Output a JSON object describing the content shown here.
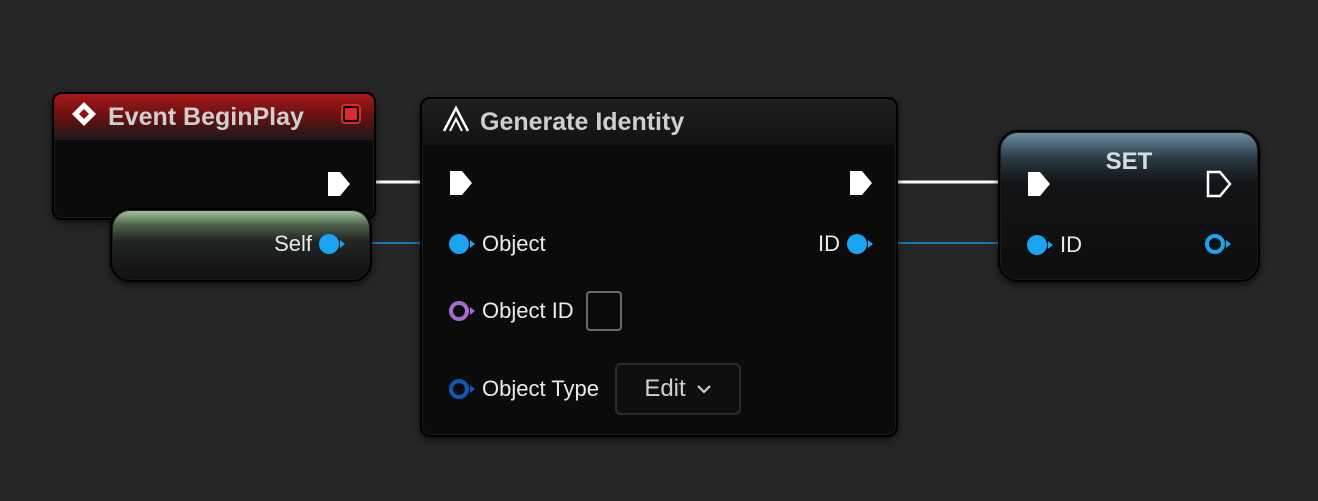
{
  "nodes": {
    "event_begin_play": {
      "title": "Event BeginPlay",
      "colors": {
        "header": "#8a1414",
        "stop": "#e02a2a"
      }
    },
    "self_node": {
      "output_label": "Self"
    },
    "generate_identity": {
      "title": "Generate Identity",
      "inputs": {
        "object": "Object",
        "object_id": "Object ID",
        "object_type": "Object Type",
        "object_type_value": "Edit"
      },
      "outputs": {
        "id": "ID"
      }
    },
    "set_node": {
      "title": "SET",
      "input_label": "ID"
    }
  },
  "colors": {
    "object_pin": "#1aa3ef",
    "object_id_pin": "#a56bd1",
    "object_type_pin": "#0c59b8",
    "exec_wire": "#ffffff",
    "data_wire": "#1979b5"
  }
}
